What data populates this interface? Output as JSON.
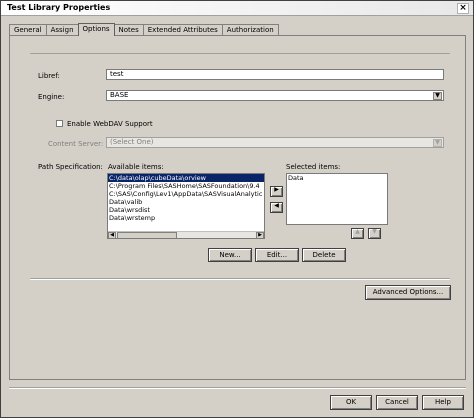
{
  "window": {
    "title": "Test Library Properties",
    "close_glyph": "×"
  },
  "tabs": [
    {
      "label": "General"
    },
    {
      "label": "Assign"
    },
    {
      "label": "Options"
    },
    {
      "label": "Notes"
    },
    {
      "label": "Extended Attributes"
    },
    {
      "label": "Authorization"
    }
  ],
  "form": {
    "libref_label": "Libref:",
    "libref_value": "test",
    "engine_label": "Engine:",
    "engine_value": "BASE",
    "webdav_label": "Enable WebDAV Support",
    "content_server_label": "Content Server:",
    "content_server_value": "(Select One)",
    "path_spec_label": "Path Specification:",
    "available_label": "Available items:",
    "selected_label": "Selected items:",
    "available_items": [
      "C:\\data\\olap\\cubeData\\orview",
      "C:\\Program Files\\SASHome\\SASFoundation\\9.4",
      "C:\\SAS\\Config\\Lev1\\AppData\\SASVisualAnalytic",
      "Data\\valib",
      "Data\\wrsdist",
      "Data\\wrstemp"
    ],
    "selected_items": [
      "Data"
    ],
    "add_glyph": "▶",
    "remove_glyph": "◀",
    "up_glyph": "▲",
    "down_glyph": "▼",
    "dropdown_glyph": "▼",
    "new_button": "New...",
    "edit_button": "Edit...",
    "delete_button": "Delete",
    "advanced_button": "Advanced Options..."
  },
  "footer": {
    "ok": "OK",
    "cancel": "Cancel",
    "help": "Help"
  }
}
